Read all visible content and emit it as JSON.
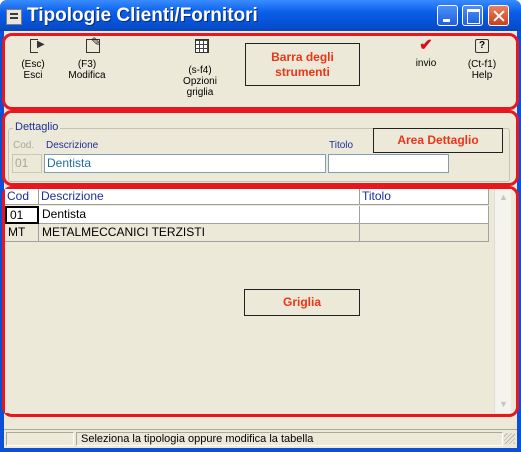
{
  "window": {
    "title": "Tipologie Clienti/Fornitori"
  },
  "toolbar": {
    "exit_key": "(Esc)",
    "exit_label": "Esci",
    "edit_key": "(F3)",
    "edit_label": "Modifica",
    "grid_key": "(s-f4)",
    "grid_label_1": "Opzioni",
    "grid_label_2": "griglia",
    "send_label": "invio",
    "help_key": "(Ct-f1)",
    "help_label": "Help",
    "annotation_line_1": "Barra degli",
    "annotation_line_2": "strumenti"
  },
  "detail": {
    "group_label": "Dettaglio",
    "cod_label": "Cod.",
    "cod_value": "01",
    "descr_label": "Descrizione",
    "descr_value": "Dentista",
    "title_label": "Titolo",
    "title_value": "",
    "annotation": "Area Dettaglio"
  },
  "grid": {
    "columns": [
      "Cod",
      "Descrizione",
      "Titolo"
    ],
    "rows": [
      {
        "cod": "01",
        "descrizione": "Dentista",
        "titolo": ""
      },
      {
        "cod": "MT",
        "descrizione": "METALMECCANICI TERZISTI",
        "titolo": ""
      }
    ],
    "annotation": "Griglia"
  },
  "status": {
    "message": "Seleziona la tipologia oppure modifica la tabella"
  },
  "colors": {
    "annotation_red": "#e8161e",
    "titlebar_blue": "#0a5ee8",
    "face": "#ece9d8"
  },
  "icons": {
    "exit": "exit-icon",
    "edit": "edit-icon",
    "grid": "grid-options-icon",
    "send": "checkmark-icon",
    "help": "help-icon"
  }
}
